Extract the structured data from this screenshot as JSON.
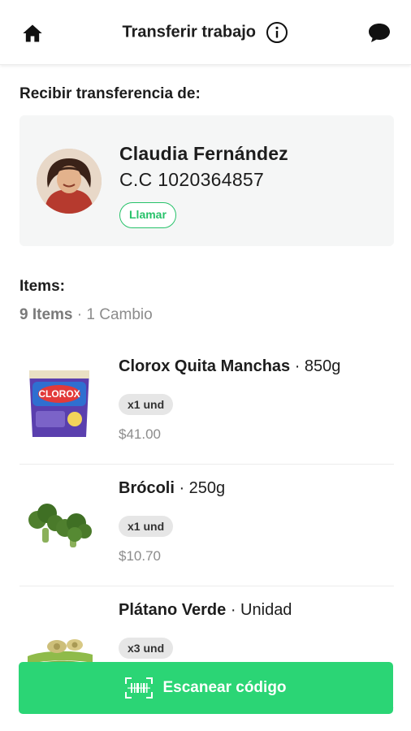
{
  "header": {
    "title": "Transferir trabajo",
    "home_icon": "home-icon",
    "info_icon": "info-icon",
    "chat_icon": "chat-bubble-icon"
  },
  "transfer": {
    "label": "Recibir transferencia de:",
    "name": "Claudia Fernández",
    "document": "C.C 1020364857",
    "call_label": "Llamar",
    "accent_color": "#27c26a"
  },
  "items_section": {
    "label": "Items:",
    "count": "9 Items",
    "separator": " · ",
    "changes": "1 Cambio"
  },
  "items": [
    {
      "name": "Clorox Quita Manchas",
      "size": " · 850g",
      "qty": "x1 und",
      "price": "$41.00",
      "image_icon": "clorox-bag-icon"
    },
    {
      "name": "Brócoli",
      "size": " · 250g",
      "qty": "x1 und",
      "price": "$10.70",
      "image_icon": "broccoli-icon"
    },
    {
      "name": "Plátano Verde",
      "size": " · Unidad",
      "qty": "x3 und",
      "price": "",
      "image_icon": "green-plantain-icon"
    }
  ],
  "scan_button": {
    "label": "Escanear código",
    "icon": "barcode-scan-icon",
    "color": "#2bd575"
  }
}
